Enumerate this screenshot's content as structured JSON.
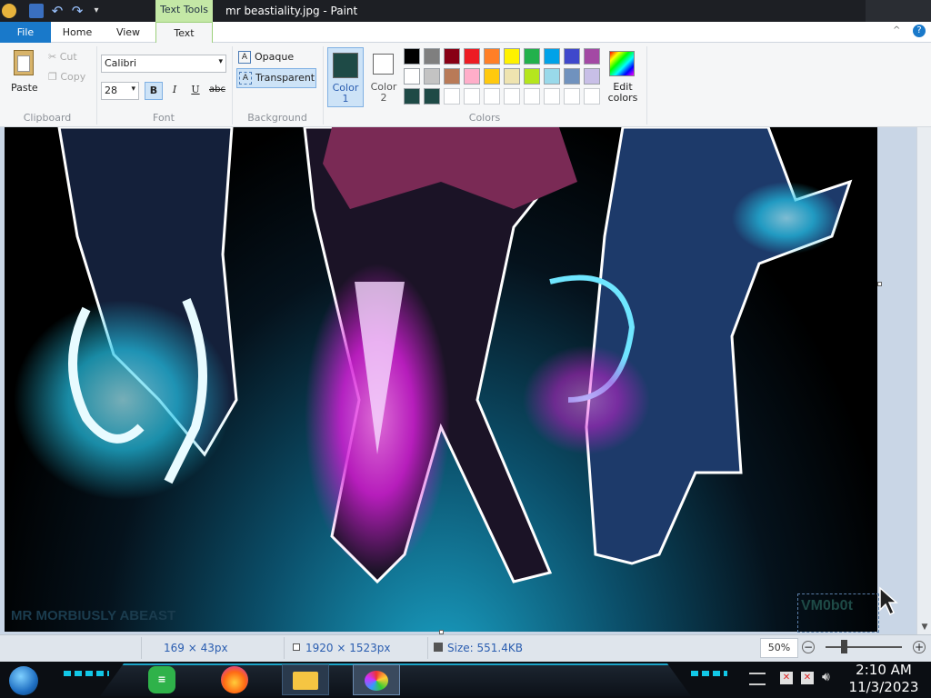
{
  "window": {
    "title": "mr beastiality.jpg - Paint",
    "contextual_tab_group": "Text Tools"
  },
  "tabs": [
    {
      "label": "File"
    },
    {
      "label": "Home"
    },
    {
      "label": "View"
    },
    {
      "label": "Text"
    }
  ],
  "ribbon": {
    "clipboard": {
      "paste": "Paste",
      "cut": "Cut",
      "copy": "Copy",
      "group": "Clipboard"
    },
    "font": {
      "family": "Calibri",
      "size": "28",
      "bold": "B",
      "italic": "I",
      "underline": "U",
      "strike": "abc",
      "group": "Font"
    },
    "background": {
      "opaque": "Opaque",
      "transparent": "Transparent",
      "group": "Background"
    },
    "colors": {
      "color1_label": "Color 1",
      "color2_label": "Color 2",
      "edit_label": "Edit colors",
      "group": "Colors",
      "color1": "#1e4a46",
      "color2": "#ffffff",
      "palette_row1": [
        "#000000",
        "#7f7f7f",
        "#880015",
        "#ed1c24",
        "#ff7f27",
        "#fff200",
        "#22b14c",
        "#00a2e8",
        "#3f48cc",
        "#a349a4"
      ],
      "palette_row2": [
        "#ffffff",
        "#c3c3c3",
        "#b97a57",
        "#ffaec9",
        "#ffc90e",
        "#efe4b0",
        "#b5e61d",
        "#99d9ea",
        "#7092be",
        "#c8bfe7"
      ],
      "palette_row3": [
        "#1e4a46",
        "#1e4a46",
        "",
        "",
        "",
        "",
        "",
        "",
        "",
        ""
      ]
    }
  },
  "canvas": {
    "watermark": "MR MORBIUSLY ABEAST",
    "text_box_value": "VM0b0t"
  },
  "statusbar": {
    "selection_size": "169 × 43px",
    "image_size": "1920 × 1523px",
    "file_size": "Size: 551.4KB",
    "zoom": "50%"
  },
  "taskbar": {
    "time": "2:10 AM",
    "date": "11/3/2023"
  }
}
